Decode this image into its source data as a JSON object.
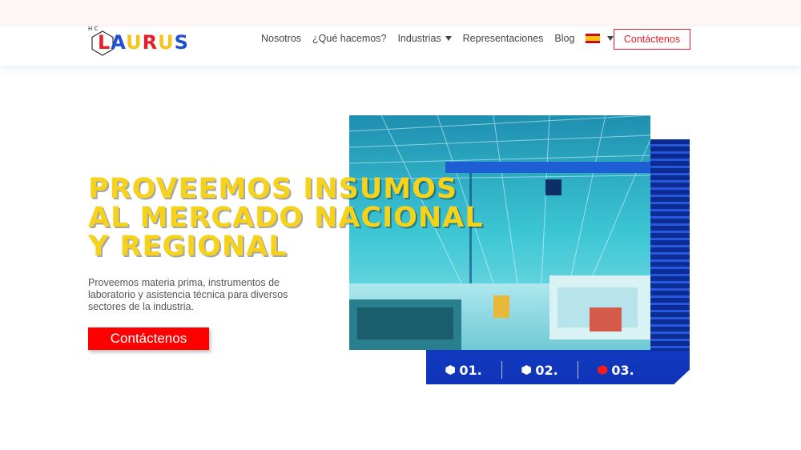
{
  "brand": {
    "logo_text": "LAURUS",
    "logo_prefix": "H C",
    "logo_letter_colors": [
      "#e41e2b",
      "#1f4fd1",
      "#f6c31b",
      "#e41e2b",
      "#f6c31b",
      "#1f4fd1"
    ]
  },
  "nav": {
    "items": [
      {
        "label": "Nosotros",
        "dropdown": false
      },
      {
        "label": "¿Qué hacemos?",
        "dropdown": false
      },
      {
        "label": "Industrias",
        "dropdown": true
      },
      {
        "label": "Representaciones",
        "dropdown": false
      },
      {
        "label": "Blog",
        "dropdown": false
      }
    ],
    "language_icon": "spain-flag-icon",
    "cta_label": "Contáctenos"
  },
  "hero": {
    "title_lines": [
      "PROVEEMOS INSUMOS",
      "AL MERCADO NACIONAL",
      "Y REGIONAL"
    ],
    "subtitle": "Proveemos materia prima, instrumentos de laboratorio y asistencia técnica para diversos sectores de la industria.",
    "cta_label": "Contáctenos"
  },
  "slider": {
    "items": [
      {
        "label": "01.",
        "active": false
      },
      {
        "label": "02.",
        "active": false
      },
      {
        "label": "03.",
        "active": true
      }
    ]
  },
  "colors": {
    "accent_red": "#ff0000",
    "title_yellow": "#f6d21b",
    "panel_blue": "#1a47d8"
  }
}
